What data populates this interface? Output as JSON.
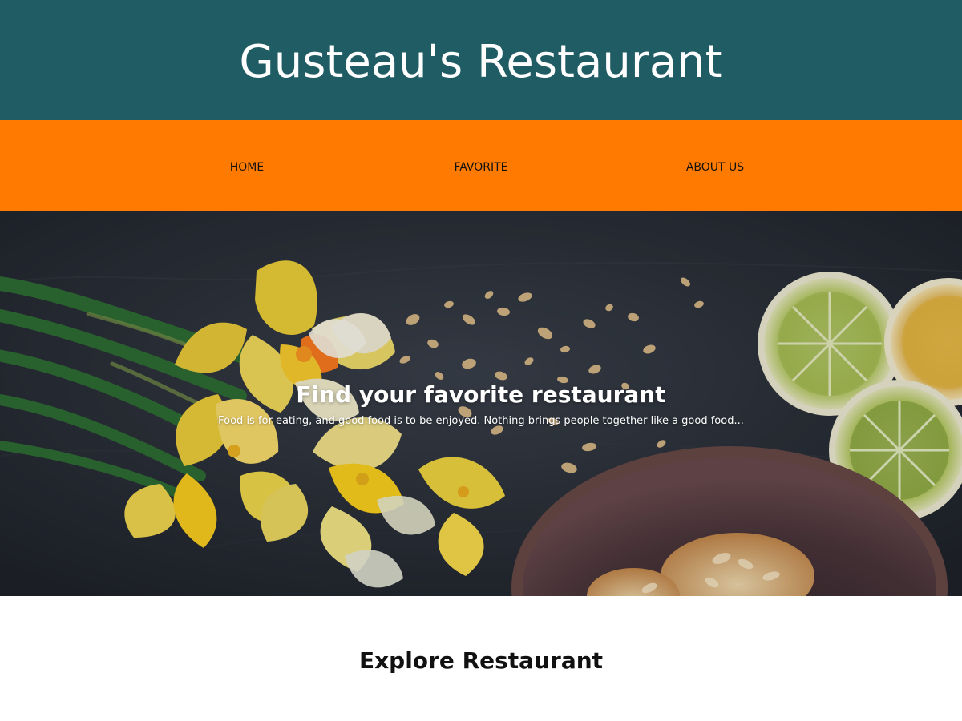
{
  "header": {
    "title": "Gusteau's Restaurant",
    "background_color": "#1f5c64"
  },
  "nav": {
    "background_color": "#ff7a00",
    "items": [
      {
        "label": "HOME"
      },
      {
        "label": "FAVORITE"
      },
      {
        "label": "ABOUT US"
      }
    ]
  },
  "hero": {
    "title": "Find your favorite restaurant",
    "subtitle": "Food is for eating, and good food is to be enjoyed. Nothing brings people together like a good food..."
  },
  "explore": {
    "title": "Explore Restaurant"
  }
}
